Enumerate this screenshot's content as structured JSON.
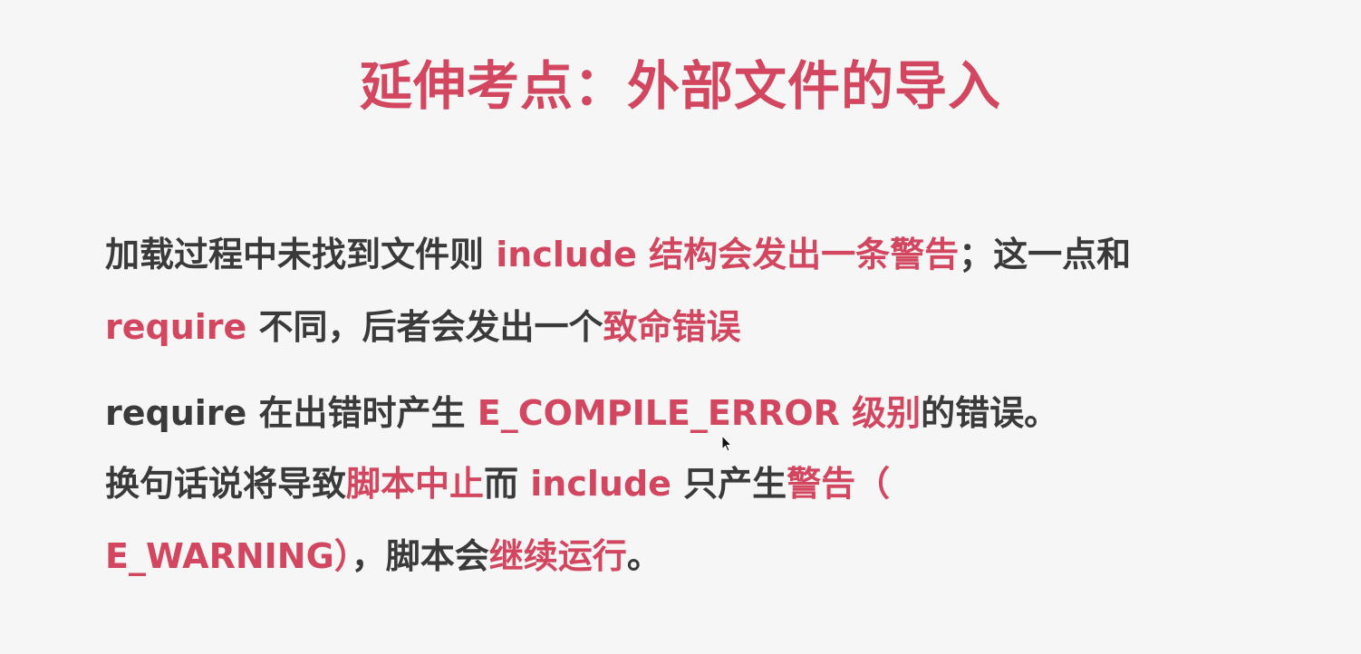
{
  "colors": {
    "background": "#f6f6f6",
    "accent": "#d2465f",
    "text": "#3a3a3a"
  },
  "slide": {
    "title": "延伸考点：外部文件的导入",
    "lines": [
      [
        {
          "text": "加载过程中未找到文件则 ",
          "highlight": false
        },
        {
          "text": "include 结构会发出一条警告",
          "highlight": true
        },
        {
          "text": "；这一点和",
          "highlight": false
        }
      ],
      [
        {
          "text": "require",
          "highlight": true
        },
        {
          "text": " 不同，后者会发出一个",
          "highlight": false
        },
        {
          "text": "致命错误",
          "highlight": true
        }
      ],
      [
        {
          "text": "require 在出错时产生 ",
          "highlight": false
        },
        {
          "text": "E_COMPILE_ERROR 级别",
          "highlight": true
        },
        {
          "text": "的错误。",
          "highlight": false
        }
      ],
      [
        {
          "text": "换句话说将导致",
          "highlight": false
        },
        {
          "text": "脚本中止",
          "highlight": true
        },
        {
          "text": "而 ",
          "highlight": false
        },
        {
          "text": "include",
          "highlight": true
        },
        {
          "text": " 只产生",
          "highlight": false
        },
        {
          "text": "警告（",
          "highlight": true
        }
      ],
      [
        {
          "text": "E_WARNING）",
          "highlight": true
        },
        {
          "text": "，脚本会",
          "highlight": false
        },
        {
          "text": "继续运行",
          "highlight": true
        },
        {
          "text": "。",
          "highlight": false
        }
      ]
    ]
  }
}
